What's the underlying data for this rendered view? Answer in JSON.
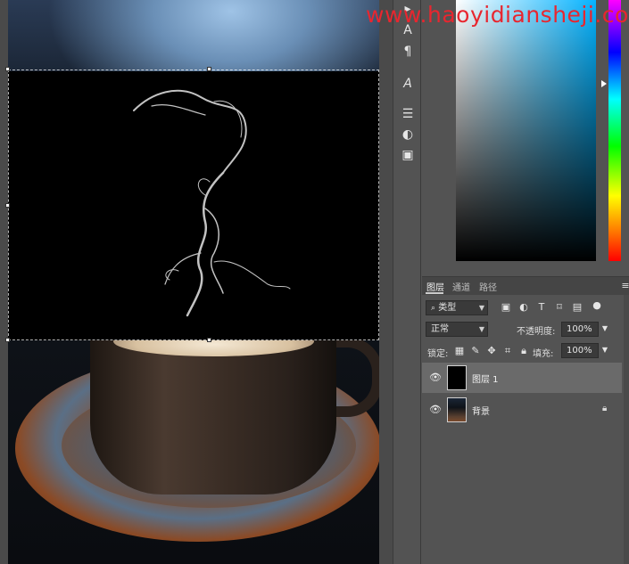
{
  "watermark": "www.haoyidiansheji.com",
  "tools": [
    "move-icon",
    "type-icon",
    "paragraph-icon",
    "glyph-icon",
    "adjust-icon",
    "circle-half-icon",
    "layer-icon"
  ],
  "tool_glyphs": [
    "▸",
    "A",
    "¶",
    "A",
    "☰",
    "◐",
    "▣"
  ],
  "layers_panel": {
    "tabs": [
      "图层",
      "通道",
      "路径"
    ],
    "kind_filter": "类型",
    "blend_mode": "正常",
    "opacity_label": "不透明度:",
    "opacity_value": "100%",
    "lock_label": "锁定:",
    "fill_label": "填充:",
    "fill_value": "100%",
    "layers": [
      {
        "name": "图层 1",
        "selected": true,
        "locked": false
      },
      {
        "name": "背景",
        "selected": false,
        "locked": true
      }
    ]
  },
  "colors": {
    "panel_bg": "#535353",
    "selected_layer": "#6a6a6a",
    "watermark": "#e8262f"
  }
}
